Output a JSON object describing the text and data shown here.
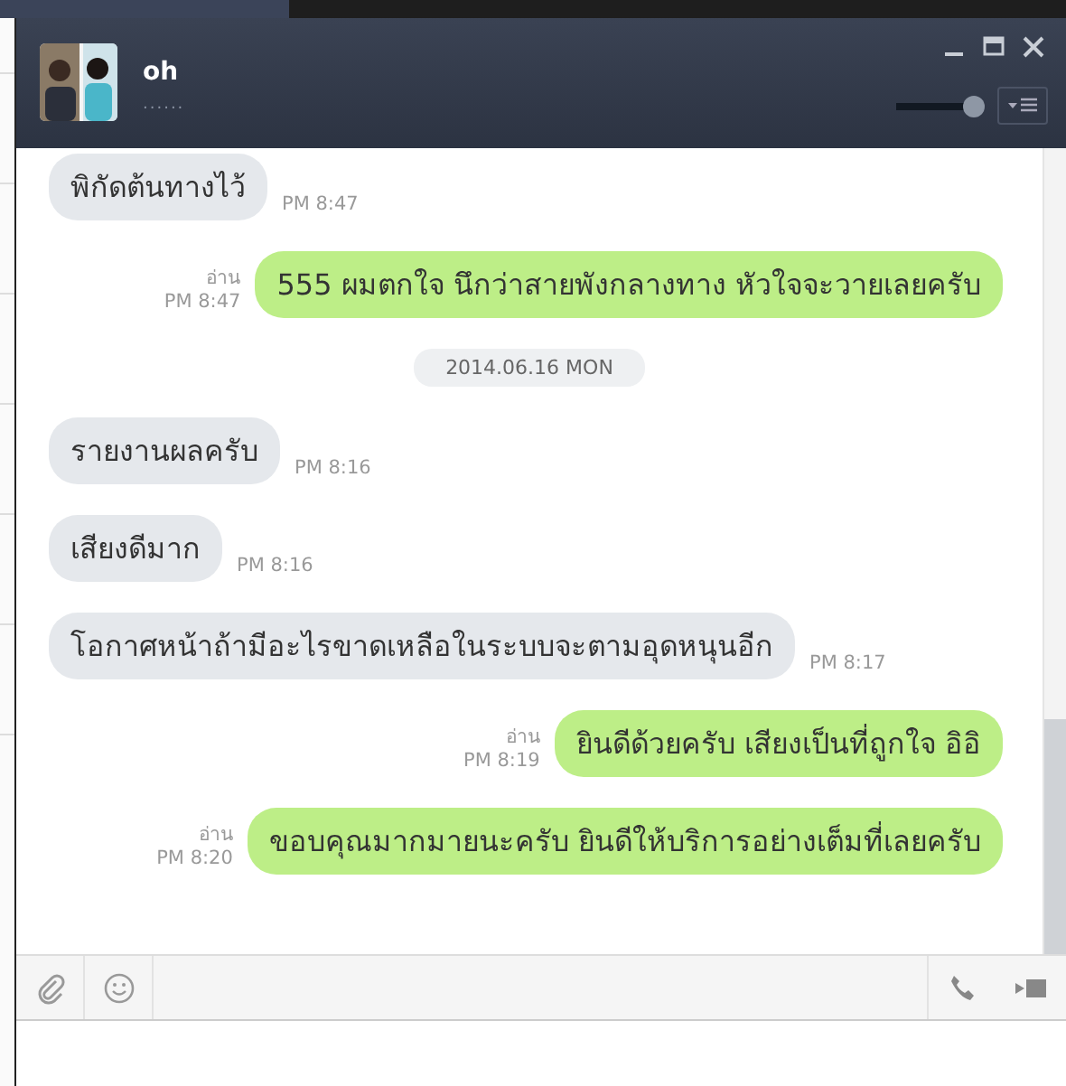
{
  "chat": {
    "name": "oh",
    "status": "......",
    "volume": {
      "level": 0.9
    },
    "messages": [
      {
        "kind": "in",
        "text": "พิกัดต้นทางไว้",
        "time": "PM 8:47"
      },
      {
        "kind": "out",
        "text": "555 ผมตกใจ นึกว่าสายพังกลางทาง หัวใจจะวายเลยครับ",
        "read": "อ่าน",
        "time": "PM 8:47"
      },
      {
        "kind": "date",
        "text": "2014.06.16 MON"
      },
      {
        "kind": "in",
        "text": "รายงานผลครับ",
        "time": "PM 8:16"
      },
      {
        "kind": "in",
        "text": "เสียงดีมาก",
        "time": "PM 8:16"
      },
      {
        "kind": "in",
        "text": "โอกาศหน้าถ้ามีอะไรขาดเหลือในระบบจะตามอุดหนุนอีก",
        "time": "PM 8:17"
      },
      {
        "kind": "out",
        "text": "ยินดีด้วยครับ เสียงเป็นที่ถูกใจ อิอิ",
        "read": "อ่าน",
        "time": "PM 8:19"
      },
      {
        "kind": "out",
        "text": "ขอบคุณมากมายนะครับ ยินดีให้บริการอย่างเต็มที่เลยครับ",
        "read": "อ่าน",
        "time": "PM 8:20"
      }
    ]
  }
}
